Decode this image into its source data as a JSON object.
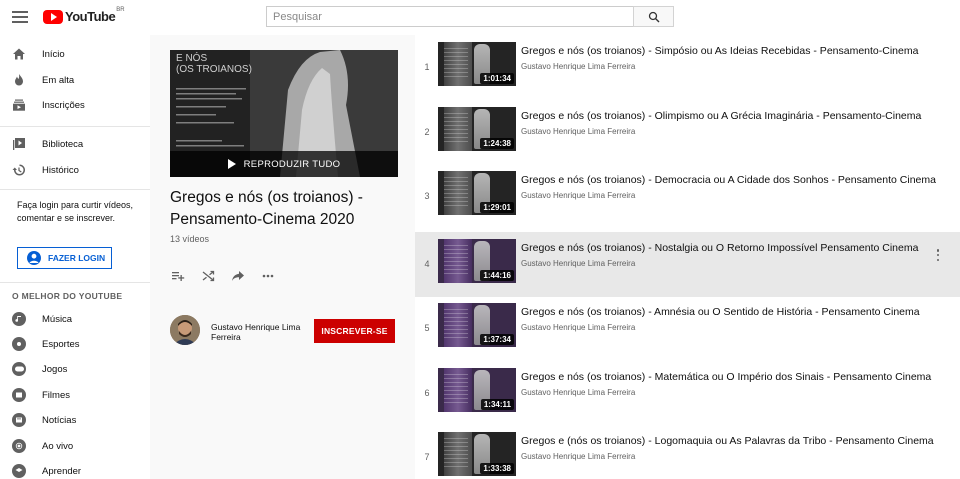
{
  "header": {
    "logo_text": "YouTube",
    "country_code": "BR",
    "search_placeholder": "Pesquisar"
  },
  "sidebar": {
    "primary": [
      {
        "label": "Início",
        "icon": "home-icon"
      },
      {
        "label": "Em alta",
        "icon": "flame-icon"
      },
      {
        "label": "Inscrições",
        "icon": "subscriptions-icon"
      }
    ],
    "secondary": [
      {
        "label": "Biblioteca",
        "icon": "library-icon"
      },
      {
        "label": "Histórico",
        "icon": "history-icon"
      }
    ],
    "login_prompt": "Faça login para curtir vídeos, comentar e se inscrever.",
    "login_button": "FAZER LOGIN",
    "best_title": "O MELHOR DO YOUTUBE",
    "best": [
      {
        "label": "Música",
        "icon": "music-icon"
      },
      {
        "label": "Esportes",
        "icon": "sports-icon"
      },
      {
        "label": "Jogos",
        "icon": "gaming-icon"
      },
      {
        "label": "Filmes",
        "icon": "movies-icon"
      },
      {
        "label": "Notícias",
        "icon": "news-icon"
      },
      {
        "label": "Ao vivo",
        "icon": "live-icon"
      },
      {
        "label": "Aprender",
        "icon": "learning-icon"
      }
    ]
  },
  "playlist": {
    "thumb_title_line1": "E NÓS",
    "thumb_title_line2": "(OS TROIANOS)",
    "play_all": "REPRODUZIR TUDO",
    "title": "Gregos e nós (os troianos) - Pensamento-Cinema 2020",
    "count": "13 vídeos",
    "owner_name": "Gustavo Henrique Lima Ferreira",
    "subscribe_label": "INSCREVER-SE"
  },
  "videos": [
    {
      "index": "1",
      "title": "Gregos e nós (os troianos) - Simpósio ou As Ideias Recebidas - Pensamento-Cinema",
      "channel": "Gustavo Henrique Lima Ferreira",
      "duration": "1:01:34"
    },
    {
      "index": "2",
      "title": "Gregos e nós (os troianos) - Olimpismo ou A Grécia Imaginária - Pensamento-Cinema",
      "channel": "Gustavo Henrique Lima Ferreira",
      "duration": "1:24:38"
    },
    {
      "index": "3",
      "title": "Gregos e nós (os troianos) - Democracia ou A Cidade dos Sonhos - Pensamento Cinema",
      "channel": "Gustavo Henrique Lima Ferreira",
      "duration": "1:29:01"
    },
    {
      "index": "4",
      "title": "Gregos e nós (os troianos) - Nostalgia ou O Retorno Impossível Pensamento Cinema",
      "channel": "Gustavo Henrique Lima Ferreira",
      "duration": "1:44:16"
    },
    {
      "index": "5",
      "title": "Gregos e nós (os troianos) - Amnésia ou O Sentido de História - Pensamento Cinema",
      "channel": "Gustavo Henrique Lima Ferreira",
      "duration": "1:37:34"
    },
    {
      "index": "6",
      "title": "Gregos e nós (os troianos) - Matemática ou O Império dos Sinais - Pensamento Cinema",
      "channel": "Gustavo Henrique Lima Ferreira",
      "duration": "1:34:11"
    },
    {
      "index": "7",
      "title": "Gregos e (nós os troianos) - Logomaquia ou As Palavras da Tribo - Pensamento Cinema",
      "channel": "Gustavo Henrique Lima Ferreira",
      "duration": "1:33:38"
    }
  ],
  "colors": {
    "accent": "#cc0000",
    "link": "#065fd4",
    "active_row": "#e8e8e8"
  }
}
